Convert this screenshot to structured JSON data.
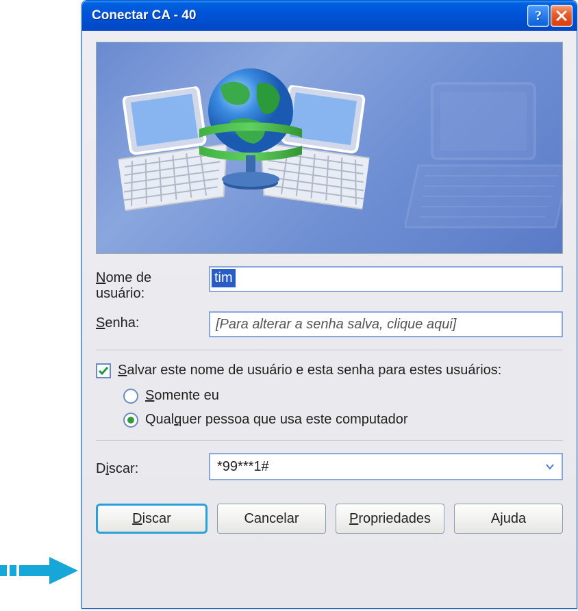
{
  "titlebar": {
    "title": "Conectar CA - 40"
  },
  "labels": {
    "username_line1": "Nome de",
    "username_line2": "usuário:",
    "username_u": "N",
    "password": "enha:",
    "password_u": "S",
    "dial": "scar:",
    "dial_u": "i",
    "dial_prefix": "D"
  },
  "fields": {
    "username": "tim",
    "password_placeholder": "[Para alterar a senha salva, clique aqui]",
    "dial_number": "*99***1#"
  },
  "checkbox": {
    "save_label": "alvar este nome de usuário e esta senha para estes usuários:",
    "save_u": "S"
  },
  "radios": {
    "only_me": "omente eu",
    "only_me_u": "S",
    "anyone_prefix": "Qual",
    "anyone_u": "q",
    "anyone_suffix": "uer pessoa que usa este computador"
  },
  "buttons": {
    "dial_u": "D",
    "dial": "iscar",
    "cancel": "Cancelar",
    "properties_u": "P",
    "properties": "ropriedades",
    "help_prefix": "A",
    "help_u": "j",
    "help_suffix": "uda"
  }
}
